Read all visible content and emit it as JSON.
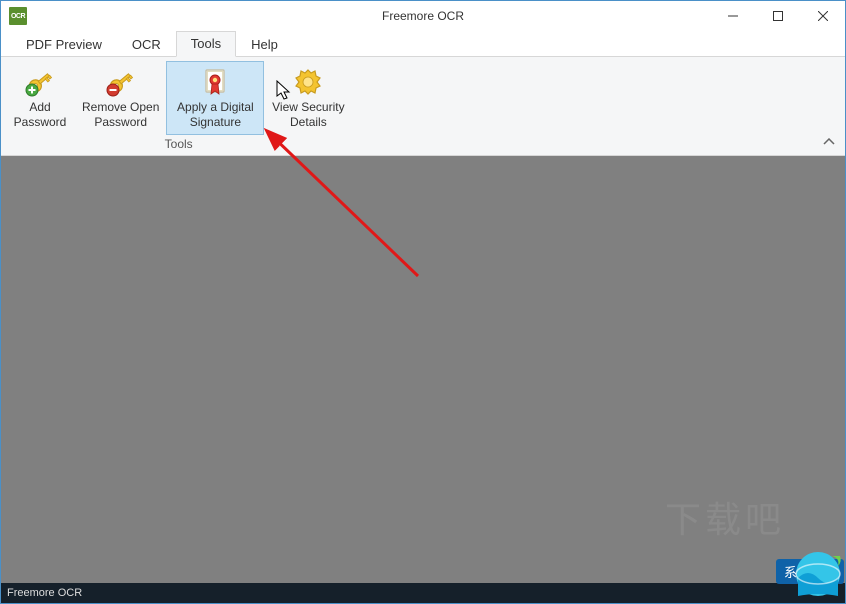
{
  "window": {
    "title": "Freemore OCR",
    "app_icon_text": "OCR"
  },
  "menu": {
    "tabs": [
      {
        "label": "PDF Preview",
        "active": false
      },
      {
        "label": "OCR",
        "active": false
      },
      {
        "label": "Tools",
        "active": true
      },
      {
        "label": "Help",
        "active": false
      }
    ]
  },
  "ribbon": {
    "group_label": "Tools",
    "buttons": [
      {
        "id": "add-password",
        "label": "Add\nPassword",
        "icon": "key-add"
      },
      {
        "id": "remove-open-password",
        "label": "Remove Open\nPassword",
        "icon": "key-remove"
      },
      {
        "id": "apply-digital-signature",
        "label": "Apply a Digital\nSignature",
        "icon": "certificate",
        "hovered": true
      },
      {
        "id": "view-security-details",
        "label": "View Security\nDetails",
        "icon": "shield-badge"
      }
    ],
    "collapse_glyph": "^"
  },
  "statusbar": {
    "text": "Freemore OCR"
  },
  "watermark": {
    "badge_text": "系统天地",
    "faint_text": "下载吧"
  }
}
